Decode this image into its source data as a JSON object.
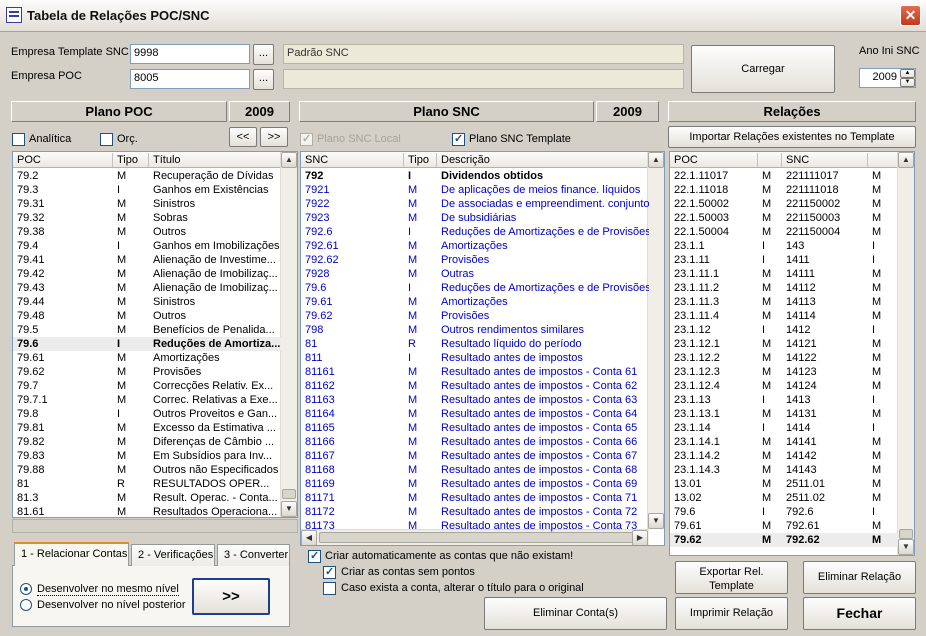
{
  "window": {
    "title": "Tabela de Relações POC/SNC",
    "close": "✕"
  },
  "top": {
    "empresa_template_label": "Empresa Template SNC",
    "empresa_template_value": "9998",
    "empresa_template_desc": "Padrão SNC",
    "empresa_poc_label": "Empresa POC",
    "empresa_poc_value": "8005",
    "empresa_poc_desc": "",
    "browse": "...",
    "carregar": "Carregar",
    "ano_label": "Ano Ini SNC",
    "ano_value": "2009"
  },
  "poc": {
    "title": "Plano POC",
    "year": "2009",
    "analitica": "Analítica",
    "orc": "Orç.",
    "prev": "<<",
    "next": ">>",
    "cols": [
      "POC",
      "Tipo",
      "Título"
    ],
    "rows": [
      [
        "79.2",
        "M",
        "Recuperação de Dívidas"
      ],
      [
        "79.3",
        "I",
        "Ganhos em Existências"
      ],
      [
        "79.31",
        "M",
        "Sinistros"
      ],
      [
        "79.32",
        "M",
        "Sobras"
      ],
      [
        "79.38",
        "M",
        "Outros"
      ],
      [
        "79.4",
        "I",
        "Ganhos em Imobilizações"
      ],
      [
        "79.41",
        "M",
        "Alienação de Investime..."
      ],
      [
        "79.42",
        "M",
        "Alienação de Imobilizaç..."
      ],
      [
        "79.43",
        "M",
        "Alienação de Imobilizaç..."
      ],
      [
        "79.44",
        "M",
        "Sinistros"
      ],
      [
        "79.48",
        "M",
        "Outros"
      ],
      [
        "79.5",
        "M",
        "Benefícios de Penalida..."
      ],
      [
        "79.6",
        "I",
        "Reduções de Amortiza..."
      ],
      [
        "79.61",
        "M",
        "Amortizações"
      ],
      [
        "79.62",
        "M",
        "Provisões"
      ],
      [
        "79.7",
        "M",
        "Correcções Relativ. Ex..."
      ],
      [
        "79.7.1",
        "M",
        "Correc. Relativas a Exe..."
      ],
      [
        "79.8",
        "I",
        "Outros Proveitos e Gan..."
      ],
      [
        "79.81",
        "M",
        "Excesso da Estimativa ..."
      ],
      [
        "79.82",
        "M",
        "Diferenças de Câmbio ..."
      ],
      [
        "79.83",
        "M",
        "Em Subsídios para Inv..."
      ],
      [
        "79.88",
        "M",
        "Outros não Especificados"
      ],
      [
        "81",
        "R",
        "RESULTADOS OPER..."
      ],
      [
        "81.3",
        "M",
        "Result. Operac. - Conta..."
      ],
      [
        "81.61",
        "M",
        "Resultados Operaciona..."
      ]
    ],
    "selected_row": 12
  },
  "snc": {
    "title": "Plano SNC",
    "year": "2009",
    "local": "Plano SNC Local",
    "template": "Plano SNC Template",
    "cols": [
      "SNC",
      "Tipo",
      "Descrição"
    ],
    "rows": [
      [
        "792",
        "I",
        "Dividendos obtidos"
      ],
      [
        "7921",
        "M",
        "De aplicações de meios finance. líquidos"
      ],
      [
        "7922",
        "M",
        "De associadas e empreendiment. conjuntos"
      ],
      [
        "7923",
        "M",
        "De subsidiárias"
      ],
      [
        "792.6",
        "I",
        "Reduções de Amortizações e de Provisões"
      ],
      [
        "792.61",
        "M",
        "Amortizações"
      ],
      [
        "792.62",
        "M",
        "Provisões"
      ],
      [
        "7928",
        "M",
        "Outras"
      ],
      [
        "79.6",
        "I",
        "Reduções de Amortizações e de Provisões"
      ],
      [
        "79.61",
        "M",
        "Amortizações"
      ],
      [
        "79.62",
        "M",
        "Provisões"
      ],
      [
        "798",
        "M",
        "Outros rendimentos similares"
      ],
      [
        "81",
        "R",
        "Resultado líquido do período"
      ],
      [
        "811",
        "I",
        "Resultado antes de impostos"
      ],
      [
        "81161",
        "M",
        "Resultado antes de impostos - Conta 61"
      ],
      [
        "81162",
        "M",
        "Resultado antes de impostos - Conta 62"
      ],
      [
        "81163",
        "M",
        "Resultado antes de impostos - Conta 63"
      ],
      [
        "81164",
        "M",
        "Resultado antes de impostos - Conta 64"
      ],
      [
        "81165",
        "M",
        "Resultado antes de impostos - Conta 65"
      ],
      [
        "81166",
        "M",
        "Resultado antes de impostos - Conta 66"
      ],
      [
        "81167",
        "M",
        "Resultado antes de impostos - Conta 67"
      ],
      [
        "81168",
        "M",
        "Resultado antes de impostos - Conta 68"
      ],
      [
        "81169",
        "M",
        "Resultado antes de impostos - Conta 69"
      ],
      [
        "81171",
        "M",
        "Resultado antes de impostos - Conta 71"
      ],
      [
        "81172",
        "M",
        "Resultado antes de impostos - Conta 72"
      ],
      [
        "81173",
        "M",
        "Resultado antes de impostos - Conta 73"
      ]
    ]
  },
  "rel": {
    "title": "Relações",
    "import": "Importar Relações existentes no Template",
    "cols": [
      "POC",
      "",
      "SNC",
      ""
    ],
    "rows": [
      [
        "22.1.11017",
        "M",
        "221111017",
        "M"
      ],
      [
        "22.1.11018",
        "M",
        "221111018",
        "M"
      ],
      [
        "22.1.50002",
        "M",
        "221150002",
        "M"
      ],
      [
        "22.1.50003",
        "M",
        "221150003",
        "M"
      ],
      [
        "22.1.50004",
        "M",
        "221150004",
        "M"
      ],
      [
        "23.1.1",
        "I",
        "143",
        "I"
      ],
      [
        "23.1.11",
        "I",
        "1411",
        "I"
      ],
      [
        "23.1.11.1",
        "M",
        "14111",
        "M"
      ],
      [
        "23.1.11.2",
        "M",
        "14112",
        "M"
      ],
      [
        "23.1.11.3",
        "M",
        "14113",
        "M"
      ],
      [
        "23.1.11.4",
        "M",
        "14114",
        "M"
      ],
      [
        "23.1.12",
        "I",
        "1412",
        "I"
      ],
      [
        "23.1.12.1",
        "M",
        "14121",
        "M"
      ],
      [
        "23.1.12.2",
        "M",
        "14122",
        "M"
      ],
      [
        "23.1.12.3",
        "M",
        "14123",
        "M"
      ],
      [
        "23.1.12.4",
        "M",
        "14124",
        "M"
      ],
      [
        "23.1.13",
        "I",
        "1413",
        "I"
      ],
      [
        "23.1.13.1",
        "M",
        "14131",
        "M"
      ],
      [
        "23.1.14",
        "I",
        "1414",
        "I"
      ],
      [
        "23.1.14.1",
        "M",
        "14141",
        "M"
      ],
      [
        "23.1.14.2",
        "M",
        "14142",
        "M"
      ],
      [
        "23.1.14.3",
        "M",
        "14143",
        "M"
      ],
      [
        "13.01",
        "M",
        "2511.01",
        "M"
      ],
      [
        "13.02",
        "M",
        "2511.02",
        "M"
      ],
      [
        "79.6",
        "I",
        "792.6",
        "I"
      ],
      [
        "79.61",
        "M",
        "792.61",
        "M"
      ],
      [
        "79.62",
        "M",
        "792.62",
        "M"
      ]
    ],
    "selected_row": 26
  },
  "tabs": [
    "1 - Relacionar Contas",
    "2 - Verificações",
    "3 - Converter"
  ],
  "options": {
    "radio1": "Desenvolver no mesmo nível",
    "radio2": "Desenvolver no nível posterior",
    "go": ">>"
  },
  "checks": {
    "auto": "Criar automaticamente as contas que não existam!",
    "sem_pontos": "Criar as contas sem pontos",
    "alterar": "Caso exista a conta, alterar o título para o original"
  },
  "buttons": {
    "eliminar_contas": "Eliminar Conta(s)",
    "exportar": "Exportar Rel. Template",
    "eliminar_rel": "Eliminar Relação",
    "imprimir": "Imprimir Relação",
    "fechar": "Fechar"
  }
}
